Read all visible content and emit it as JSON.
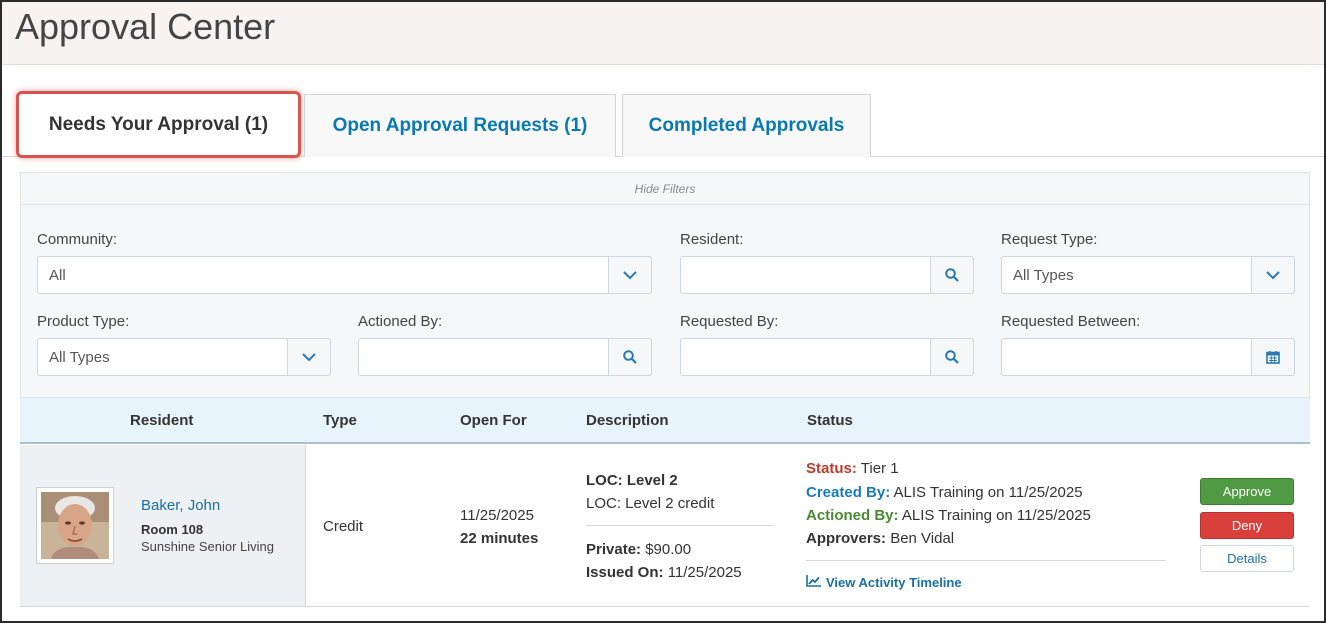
{
  "page": {
    "title": "Approval Center"
  },
  "tabs": [
    {
      "label": "Needs Your Approval  (1)",
      "active": true
    },
    {
      "label": "Open Approval Requests  (1)",
      "active": false
    },
    {
      "label": "Completed Approvals",
      "active": false
    }
  ],
  "filters": {
    "toggle_label": "Hide Filters",
    "community": {
      "label": "Community:",
      "value": "All"
    },
    "resident": {
      "label": "Resident:",
      "value": ""
    },
    "request_type": {
      "label": "Request Type:",
      "value": "All Types"
    },
    "product_type": {
      "label": "Product Type:",
      "value": "All Types"
    },
    "actioned_by": {
      "label": "Actioned By:",
      "value": ""
    },
    "requested_by": {
      "label": "Requested By:",
      "value": ""
    },
    "requested_between": {
      "label": "Requested Between:",
      "value": ""
    }
  },
  "table": {
    "headers": [
      "Resident",
      "Type",
      "Open For",
      "Description",
      "Status"
    ],
    "rows": [
      {
        "resident_name": "Baker, John",
        "room": "Room 108",
        "community": "Sunshine Senior Living",
        "type": "Credit",
        "open_date": "11/25/2025",
        "open_duration": "22 minutes",
        "loc_label": "LOC: Level 2",
        "loc_detail": "LOC: Level 2 credit",
        "private_label": "Private:",
        "private_value": "$90.00",
        "issued_label": "Issued On:",
        "issued_value": "11/25/2025",
        "status_label": "Status:",
        "status_value": "Tier 1",
        "created_label": "Created By:",
        "created_value": "ALIS Training on 11/25/2025",
        "actioned_label": "Actioned By:",
        "actioned_value": "ALIS Training on 11/25/2025",
        "approvers_label": "Approvers:",
        "approvers_value": "Ben Vidal",
        "timeline_link": "View Activity Timeline",
        "approve_label": "Approve",
        "deny_label": "Deny",
        "details_label": "Details"
      }
    ]
  },
  "colors": {
    "link": "#1a6fa5",
    "status_red": "#c0392b",
    "created_blue": "#1a7bb8",
    "actioned_green": "#4a8a34",
    "approve": "#4f9a42",
    "deny": "#d9403c",
    "highlight": "#d9534f"
  },
  "icons": {
    "dropdown": "chevron-down-icon",
    "search": "search-icon",
    "calendar": "calendar-icon",
    "timeline": "line-chart-icon"
  }
}
